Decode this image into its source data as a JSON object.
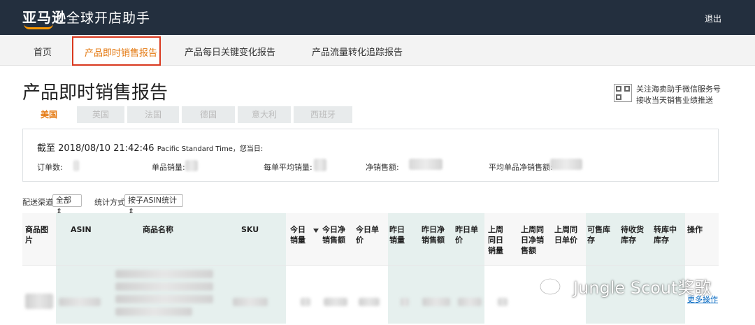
{
  "header": {
    "logo_brand": "亚马逊",
    "logo_sub": "全球开店助手",
    "logout": "退出"
  },
  "nav": {
    "items": [
      "首页",
      "产品即时销售报告",
      "产品每日关键变化报告",
      "产品流量转化追踪报告"
    ]
  },
  "page": {
    "title": "产品即时销售报告"
  },
  "qr": {
    "line1": "关注海卖助手微信服务号",
    "line2": "接收当天销售业绩推送"
  },
  "tabs": [
    "美国",
    "英国",
    "法国",
    "德国",
    "意大利",
    "西班牙"
  ],
  "summary": {
    "as_of": "截至 2018/08/10 21:42:46",
    "timezone": "Pacific Standard Time，您当日:",
    "labels": [
      "订单数:",
      "单品销量:",
      "每单平均销量:",
      "净销售额:",
      "平均单品净销售额:"
    ]
  },
  "filters": {
    "channel_label": "配送渠道",
    "channel_value": "全部",
    "stat_label": "统计方式",
    "stat_value": "按子ASIN统计"
  },
  "table": {
    "headers": [
      "商品图片",
      "ASIN",
      "商品名称",
      "SKU",
      "今日销量",
      "今日净销售额",
      "今日单价",
      "昨日销量",
      "昨日净销售额",
      "昨日单价",
      "上周同日销量",
      "上周同日净销售额",
      "上周同日单价",
      "可售库存",
      "待收货库存",
      "转库中库存",
      "操作"
    ],
    "row_action": "更多操作"
  },
  "watermark": "Jungle Scout奖歌",
  "colors": {
    "topbar": "#232f3e",
    "accent": "#e47911",
    "highlight_border": "#d9381e",
    "band": "#e6f0ee"
  }
}
